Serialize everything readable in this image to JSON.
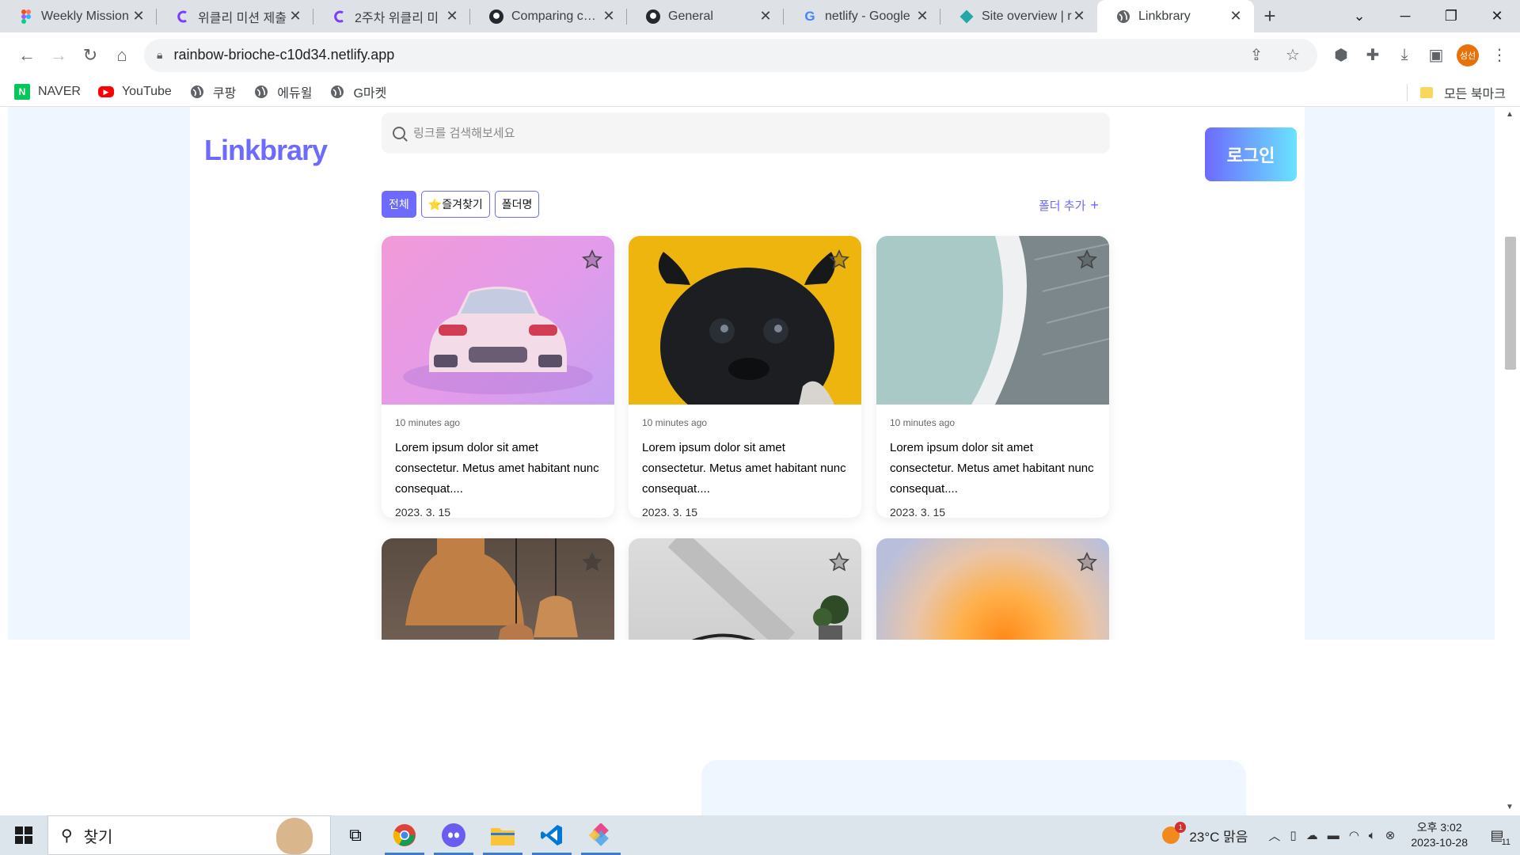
{
  "browser": {
    "tabs": [
      {
        "title": "Weekly Mission",
        "icon": "figma-icon",
        "active": false
      },
      {
        "title": "위클리 미션 제출",
        "icon": "codeit-icon",
        "active": false
      },
      {
        "title": "2주차 위클리 미",
        "icon": "codeit-icon",
        "active": false
      },
      {
        "title": "Comparing code",
        "icon": "github-icon",
        "active": false
      },
      {
        "title": "General",
        "icon": "github-icon",
        "active": false
      },
      {
        "title": "netlify - Google",
        "icon": "google-icon",
        "active": false
      },
      {
        "title": "Site overview | r",
        "icon": "netlify-icon",
        "active": false
      },
      {
        "title": "Linkbrary",
        "icon": "globe-icon",
        "active": true
      }
    ],
    "url": "rainbow-brioche-c10d34.netlify.app",
    "profile_initials": "성선",
    "bookmarks": [
      {
        "label": "NAVER",
        "icon": "naver-icon"
      },
      {
        "label": "YouTube",
        "icon": "youtube-icon"
      },
      {
        "label": "쿠팡",
        "icon": "globe-icon"
      },
      {
        "label": "에듀윌",
        "icon": "globe-icon"
      },
      {
        "label": "G마켓",
        "icon": "globe-icon"
      }
    ],
    "all_bookmarks_label": "모든 북마크"
  },
  "page": {
    "logo": "Linkbrary",
    "search_placeholder": "링크를 검색해보세요",
    "login_label": "로그인",
    "chips": [
      {
        "label": "전체",
        "active": true
      },
      {
        "label": "⭐즐겨찾기",
        "active": false
      },
      {
        "label": "폴더명",
        "active": false
      }
    ],
    "add_folder_label": "폴더 추가",
    "add_folder_icon": "+",
    "cards": [
      {
        "thumb": "car",
        "time": "10 minutes ago",
        "desc": "Lorem ipsum dolor sit amet consectetur. Metus amet habitant nunc consequat....",
        "date": "2023. 3. 15"
      },
      {
        "thumb": "pug",
        "time": "10 minutes ago",
        "desc": "Lorem ipsum dolor sit amet consectetur. Metus amet habitant nunc consequat....",
        "date": "2023. 3. 15"
      },
      {
        "thumb": "arch",
        "time": "10 minutes ago",
        "desc": "Lorem ipsum dolor sit amet consectetur. Metus amet habitant nunc consequat....",
        "date": "2023. 3. 15"
      },
      {
        "thumb": "lamp",
        "time": "",
        "desc": "",
        "date": ""
      },
      {
        "thumb": "room",
        "time": "",
        "desc": "",
        "date": ""
      },
      {
        "thumb": "grad",
        "time": "",
        "desc": "",
        "date": ""
      }
    ]
  },
  "taskbar": {
    "search_label": "찾기",
    "weather": "23°C  맑음",
    "weather_badge": "1",
    "time": "오후 3:02",
    "date": "2023-10-28",
    "notification_count": "11"
  },
  "colors": {
    "brand": "#6d6afe",
    "page_bg": "#f0f6ff"
  }
}
